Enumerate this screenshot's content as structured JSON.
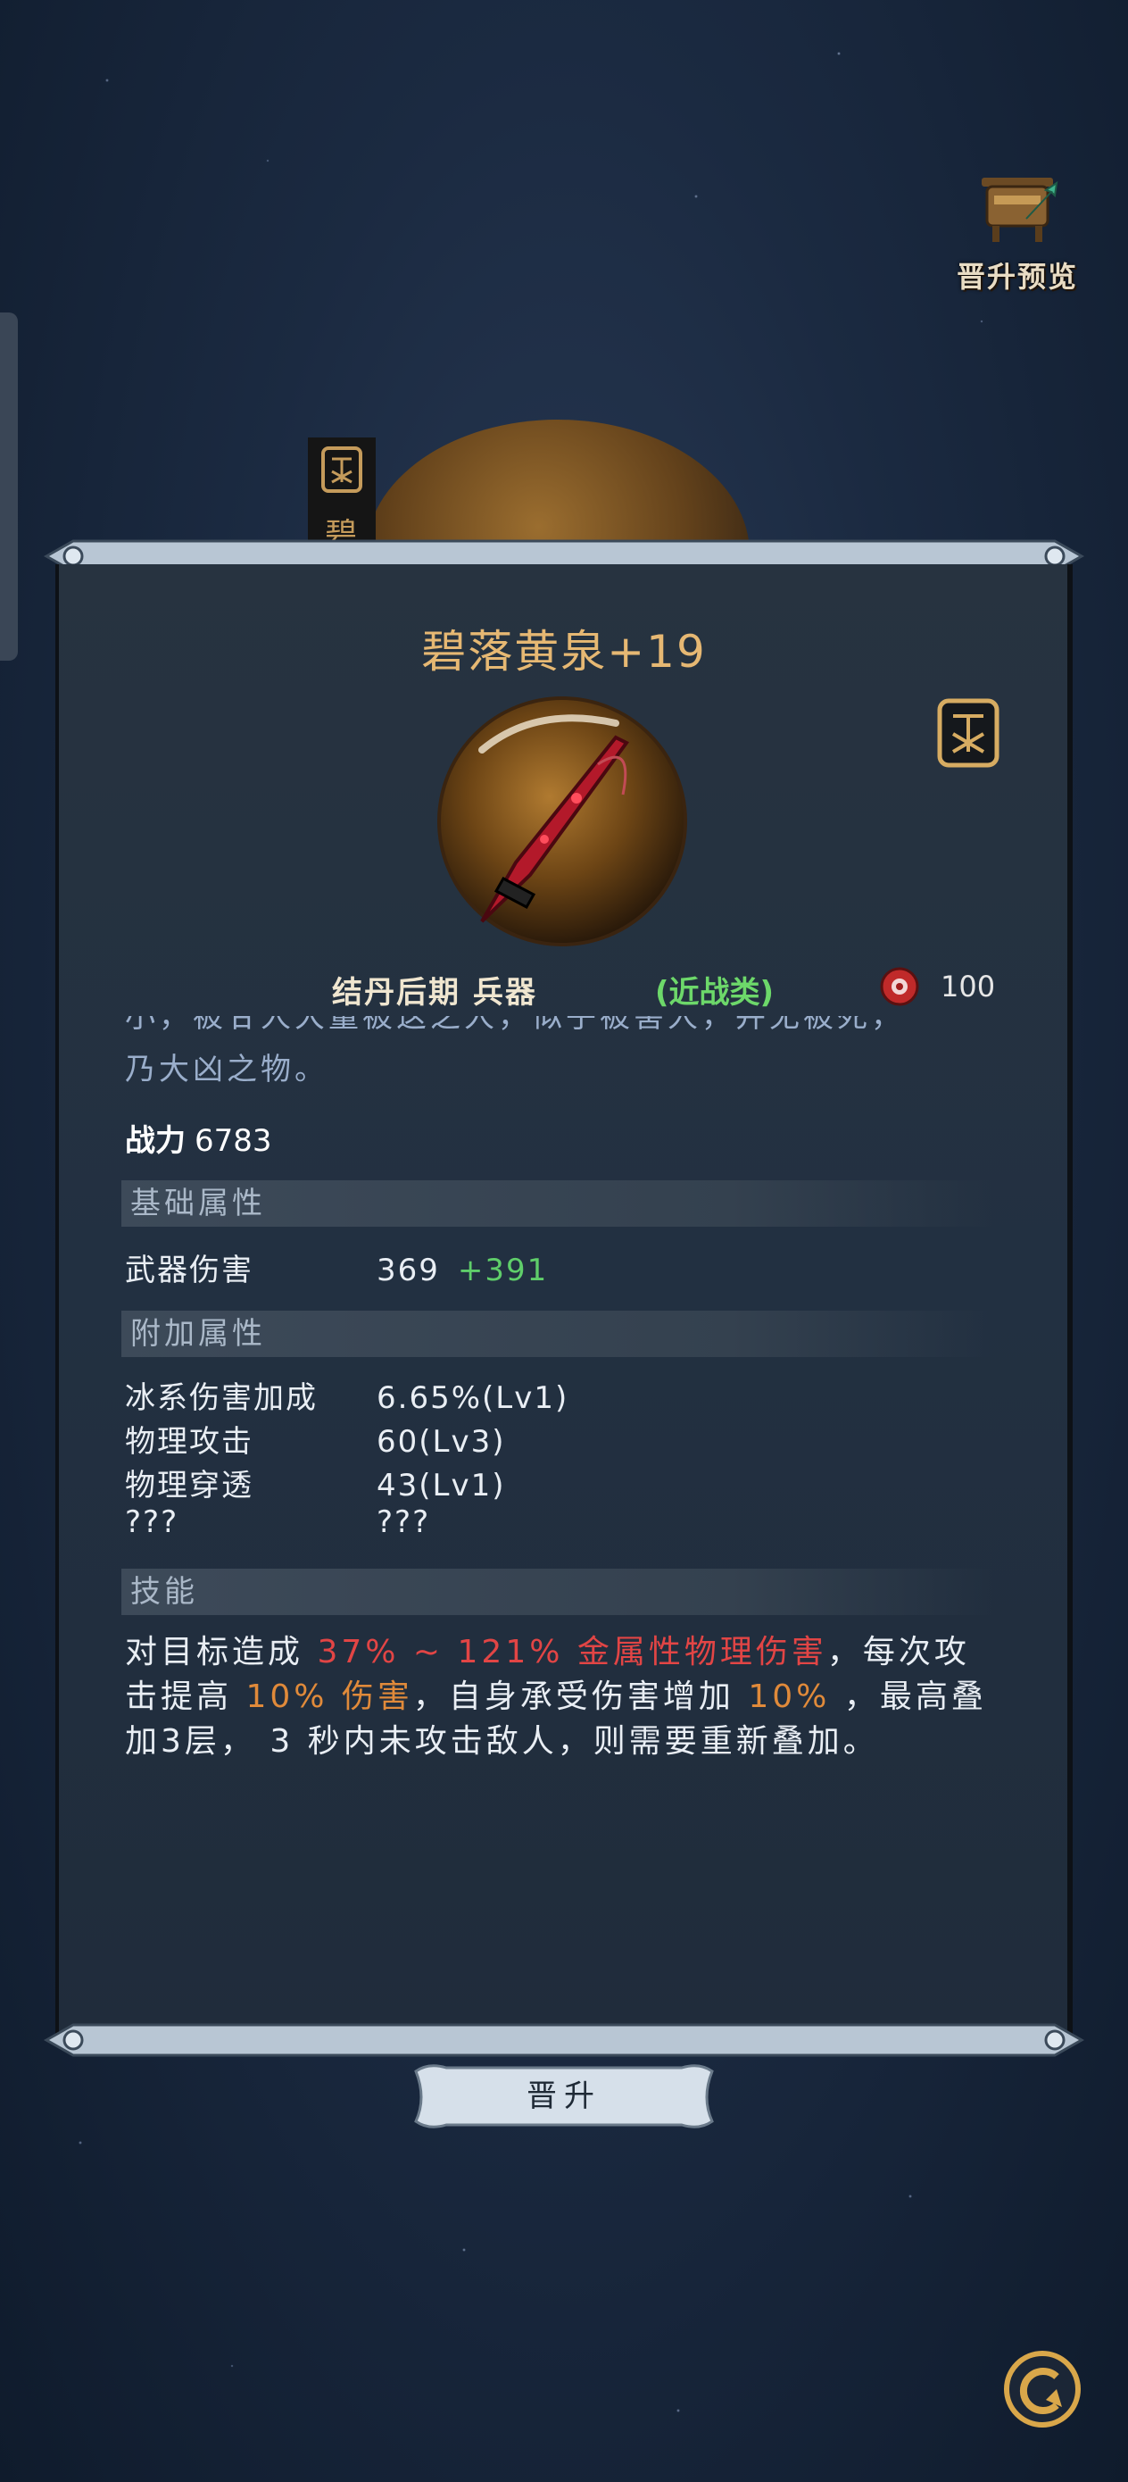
{
  "top_right": {
    "preview_label": "晋升预览",
    "icon": "cauldron-icon"
  },
  "background": {
    "stamp_icon": "grade-stamp-icon",
    "char": "碧"
  },
  "item": {
    "name": "碧落黄泉+19",
    "grade_icon": "grade-stamp-icon",
    "realm_type": "结丹后期 兵器",
    "category": "(近战类)",
    "gem_icon": "red-gem-icon",
    "level_value": "100",
    "desc_clipped": "小，被甘人大量被这之人，似乎被害人，并无被死，",
    "desc_last": "乃大凶之物。",
    "power_label": "战力",
    "power_value": "6783"
  },
  "base_attr": {
    "title": "基础属性",
    "rows": [
      {
        "name": "武器伤害",
        "value": "369",
        "bonus": "+391"
      }
    ]
  },
  "extra_attr": {
    "title": "附加属性",
    "rows": [
      {
        "name": "冰系伤害加成",
        "value": "6.65%(Lv1)"
      },
      {
        "name": "物理攻击",
        "value": "60(Lv3)"
      },
      {
        "name": "物理穿透",
        "value": "43(Lv1)"
      },
      {
        "name": "???",
        "value": "???"
      }
    ]
  },
  "skill": {
    "title": "技能",
    "parts": [
      "对目标造成 ",
      "37% ~ 121% 金属性物理伤害",
      "，每次攻击提高 ",
      "10% 伤害",
      "，自身承受伤害增加 ",
      "10%",
      " ，最高叠加3层， 3 秒内未攻击敌人，则需要重新叠加。"
    ]
  },
  "actions": {
    "promote_label": "晋升",
    "back_icon": "back-arrow-icon"
  },
  "colors": {
    "title": "#e6b873",
    "category": "#6dd86a",
    "bonus": "#5fce6a",
    "skill_red": "#e24545",
    "skill_orange": "#e08a3a"
  }
}
